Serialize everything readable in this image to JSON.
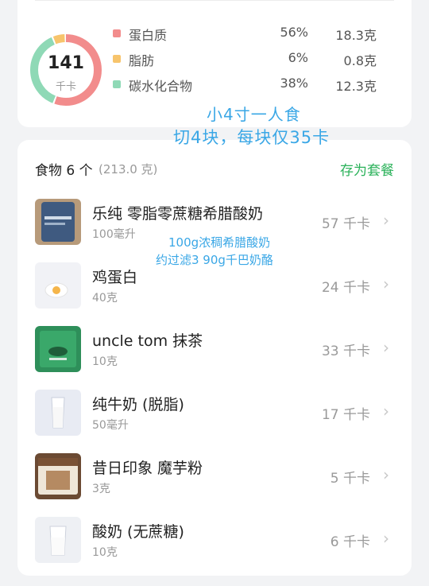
{
  "summary": {
    "kcal": "141",
    "kcal_unit": "千卡",
    "macros": [
      {
        "name": "蛋白质",
        "pct": "56%",
        "amount": "18.3克",
        "color": "#f28c8c",
        "fraction": 0.56
      },
      {
        "name": "脂肪",
        "pct": "6%",
        "amount": "0.8克",
        "color": "#f7c46c",
        "fraction": 0.06
      },
      {
        "name": "碳水化合物",
        "pct": "38%",
        "amount": "12.3克",
        "color": "#8fd9b6",
        "fraction": 0.38
      }
    ]
  },
  "notes": {
    "line1": "小4寸一人食",
    "line2": "切4块，每块仅35卡",
    "line3": "100g浓稠希腊酸奶",
    "line4": "约过滤3 90g千巴奶酪"
  },
  "list": {
    "title": "食物 6 个",
    "total_weight": "(213.0 克)",
    "save_label": "存为套餐",
    "items": [
      {
        "name": "乐纯 零脂零蔗糖希腊酸奶",
        "amount": "100毫升",
        "kcal": "57 千卡"
      },
      {
        "name": "鸡蛋白",
        "amount": "40克",
        "kcal": "24 千卡"
      },
      {
        "name": "uncle tom 抹茶",
        "amount": "10克",
        "kcal": "33 千卡"
      },
      {
        "name": "纯牛奶 (脱脂)",
        "amount": "50毫升",
        "kcal": "17 千卡"
      },
      {
        "name": "昔日印象 魔芋粉",
        "amount": "3克",
        "kcal": "5 千卡"
      },
      {
        "name": "酸奶 (无蔗糖)",
        "amount": "10克",
        "kcal": "6 千卡"
      }
    ]
  }
}
